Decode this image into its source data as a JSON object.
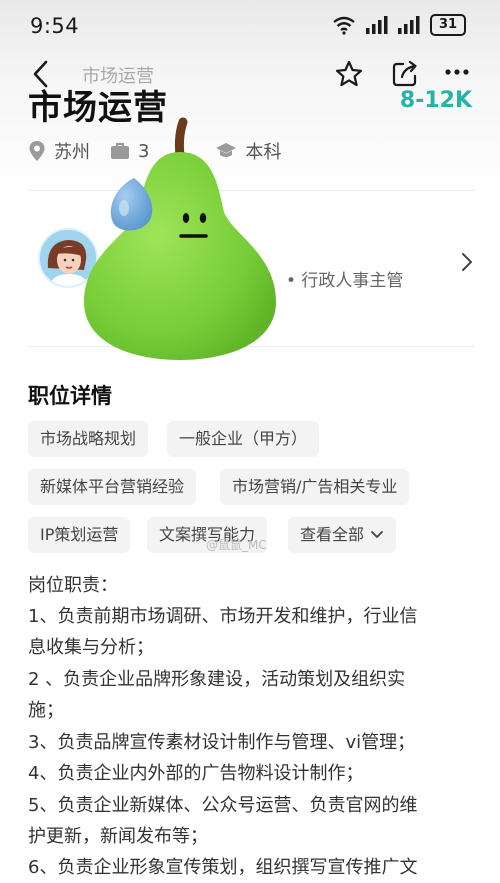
{
  "status_bar": {
    "time": "9:54",
    "battery": "31"
  },
  "nav": {
    "title": "市场运营"
  },
  "job": {
    "title": "市场运营",
    "salary": "8-12K",
    "location": "苏州",
    "experience": "3",
    "education": "本科"
  },
  "recruiter": {
    "role": "• 行政人事主管"
  },
  "details": {
    "section_title": "职位详情",
    "tags": [
      "市场战略规划",
      "一般企业（甲方）",
      "新媒体平台营销经验",
      "市场营销/广告相关专业",
      "IP策划运营",
      "文案撰写能力"
    ],
    "view_all": "查看全部"
  },
  "watermark": "@鼠鼠_MC",
  "description": {
    "heading": "岗位职责：",
    "lines": [
      "1、负责前期市场调研、市场开发和维护，行业信",
      "息收集与分析；",
      "2 、负责企业品牌形象建设，活动策划及组织实",
      "施；",
      "3、负责品牌宣传素材设计制作与管理、vi管理；",
      "4、负责企业内外部的广告物料设计制作；",
      "5、负责企业新媒体、公众号运营、负责官网的维",
      "护更新，新闻发布等；",
      "6、负责企业形象宣传策划，组织撰写宣传推广文"
    ]
  },
  "colors": {
    "salary": "#24b3a4",
    "pear": "#7fd13b",
    "drop": "#6aa9d8"
  }
}
